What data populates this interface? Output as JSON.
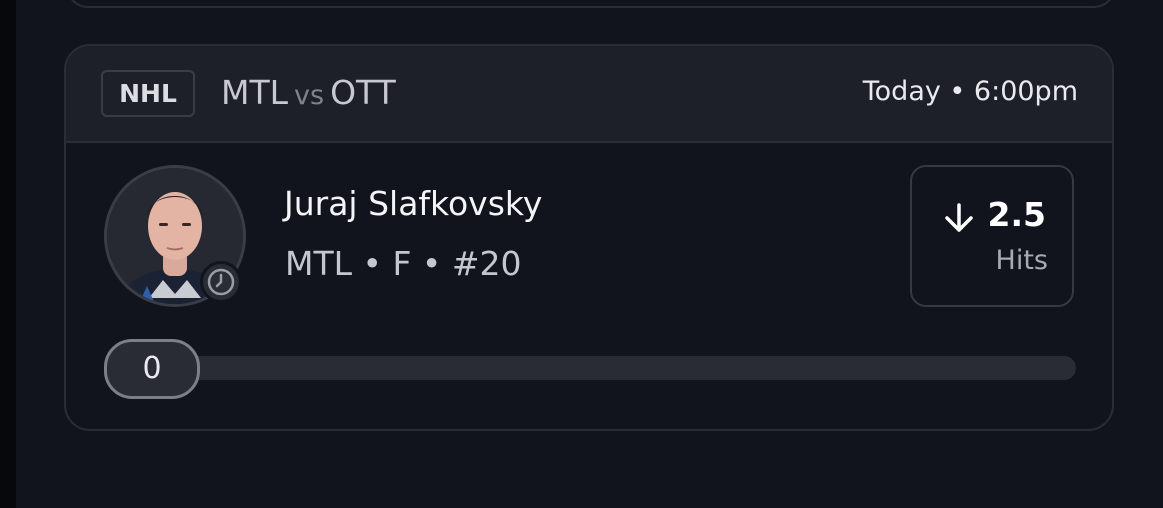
{
  "card": {
    "league": "NHL",
    "matchup": {
      "home": "MTL",
      "vs": "vs",
      "away": "OTT"
    },
    "game_time": "Today • 6:00pm"
  },
  "player": {
    "name": "Juraj Slafkovsky",
    "meta": "MTL • F • #20",
    "status_icon": "clock-icon"
  },
  "projection": {
    "direction_icon": "arrow-down-icon",
    "line": "2.5",
    "stat": "Hits"
  },
  "progress": {
    "current": "0",
    "fraction": 0
  },
  "colors": {
    "background": "#12141d",
    "header": "#1e2029",
    "border": "#2b2d36"
  }
}
